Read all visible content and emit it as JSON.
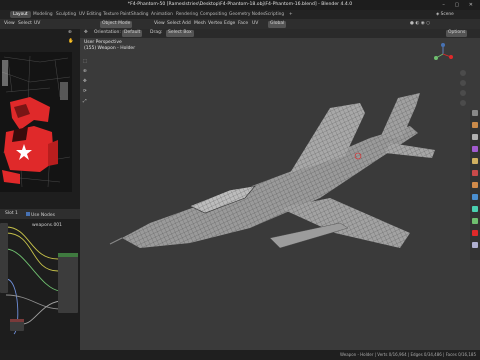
{
  "window": {
    "title": "*F4-Phantom-50 [RamesIstries\\Desktop\\F4-Phantom-18.obj\\F4-Phantom-16.blend] - Blender 4.4.0"
  },
  "tabs": [
    "Layout",
    "Modeling",
    "Sculpting",
    "UV Editing",
    "Texture Paint",
    "Shading",
    "Animation",
    "Rendering",
    "Compositing",
    "Geometry Nodes",
    "Scripting",
    "+"
  ],
  "scene": "Scene",
  "left_panel": {
    "menu": [
      "View",
      "Select",
      "UV"
    ]
  },
  "viewport": {
    "menu": [
      "Object Mode",
      "View",
      "Select",
      "Add",
      "Mesh",
      "Vertex",
      "Edge",
      "Face",
      "UV"
    ],
    "header2": {
      "orientation": "Orientation:",
      "orientation_value": "Default",
      "drag": "Drag:",
      "drag_value": "Select Box"
    },
    "overlay_line1": "User Perspective",
    "overlay_line2": "(155) Weapon - Holder",
    "options": "Options",
    "global": "Global"
  },
  "node_panel": {
    "slot": "Slot 1",
    "use_nodes": "Use Nodes",
    "material": "weapons.001"
  },
  "status": {
    "text": "Weapon - Holder  |  Verts 0/16,964  |  Edges 0/34,486  |  Faces 0/16,185"
  },
  "colors": {
    "accent": "#4772b3",
    "red": "#e0292a",
    "node_yellow": "#c7c24a",
    "node_green": "#6fbf6f",
    "node_blue": "#6f8fd9"
  }
}
